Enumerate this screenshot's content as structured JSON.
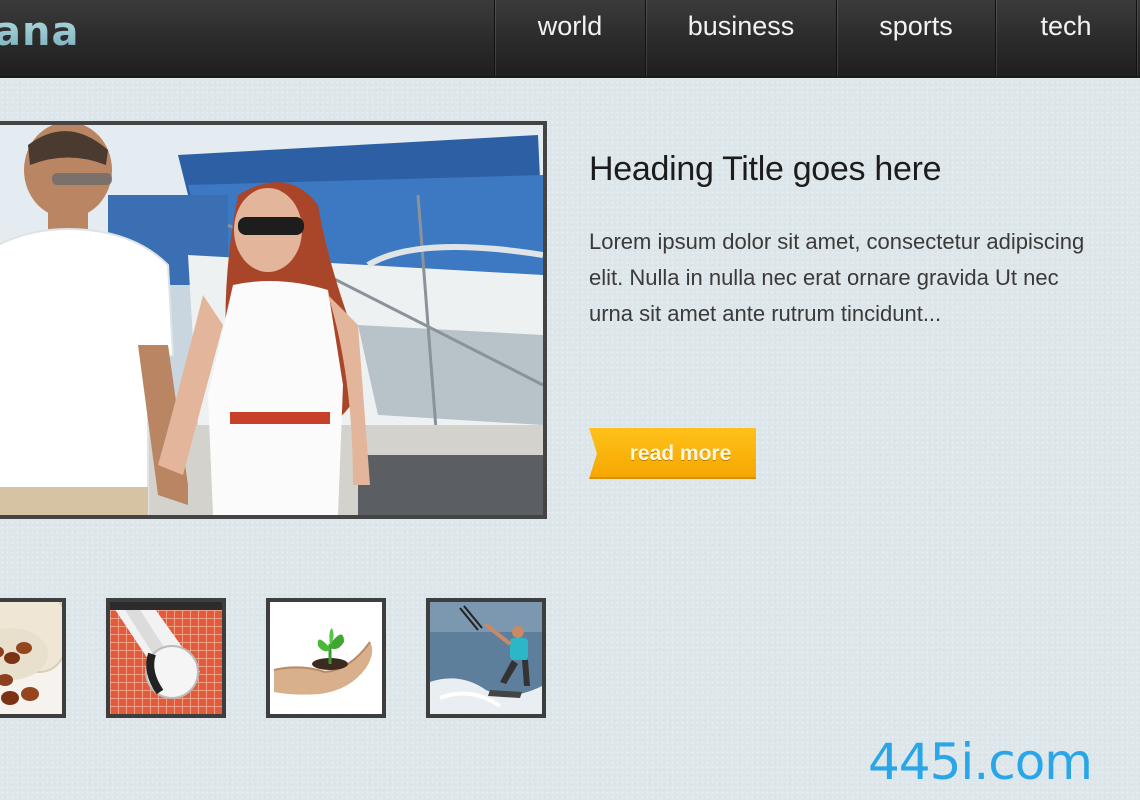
{
  "header": {
    "logo_text": "ana",
    "nav": [
      {
        "label": "world"
      },
      {
        "label": "business"
      },
      {
        "label": "sports"
      },
      {
        "label": "tech"
      }
    ]
  },
  "feature": {
    "image_icon": "couple-at-marina-photo"
  },
  "article": {
    "heading": "Heading Title goes here",
    "excerpt": "Lorem ipsum dolor sit amet, consectetur adipiscing elit. Nulla in nulla nec erat ornare gravida Ut nec urna sit amet ante rutrum tincidunt...",
    "read_more_label": "read more"
  },
  "thumbnails": [
    {
      "icon": "pill-bottle-photo"
    },
    {
      "icon": "badminton-shuttlecock-photo"
    },
    {
      "icon": "hand-holding-sprout-photo"
    },
    {
      "icon": "kitesurfer-photo"
    }
  ],
  "watermark": "445i.com",
  "colors": {
    "background": "#dde6ea",
    "header": "#2a2a2a",
    "accent_button": "#f5a600",
    "logo": "#8fc4cf",
    "watermark": "#2aa6e8"
  }
}
